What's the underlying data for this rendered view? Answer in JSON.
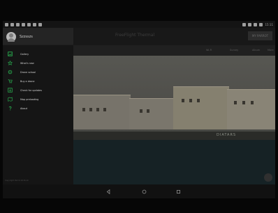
{
  "status_bar": {
    "time": "15:11",
    "left_icons": [
      "notification-icon",
      "notification-icon",
      "notification-icon",
      "notification-icon",
      "notification-icon",
      "notification-icon",
      "notification-icon"
    ],
    "right_icons": [
      "bluetooth-icon",
      "wifi-icon",
      "signal-icon",
      "battery-icon"
    ]
  },
  "app_bar": {
    "title": "FreeFlight Thermal",
    "my_parrot": "MY PARROT"
  },
  "media_bar": {
    "items": [
      "Wi-Fi",
      "Survey",
      "Album",
      "More"
    ]
  },
  "drawer": {
    "profile_name": "Szzsszs",
    "items": [
      {
        "label": "Gallery",
        "icon": "gallery-icon"
      },
      {
        "label": "What's new",
        "icon": "star-icon"
      },
      {
        "label": "Drone school",
        "icon": "drone-icon"
      },
      {
        "label": "Buy a drone",
        "icon": "cart-icon"
      },
      {
        "label": "Check for updates",
        "icon": "update-icon"
      },
      {
        "label": "Map preloading",
        "icon": "map-icon"
      },
      {
        "label": "About",
        "icon": "question-icon"
      }
    ],
    "copyright": "Copyright Parrot 2016 All"
  },
  "photo": {
    "graffiti": "DIATARS"
  },
  "nav": {
    "buttons": [
      "back-icon",
      "home-icon",
      "recents-icon"
    ]
  },
  "colors": {
    "accent_green": "#27a34b",
    "drawer_background": "#151515",
    "navbar_background": "#111111"
  }
}
